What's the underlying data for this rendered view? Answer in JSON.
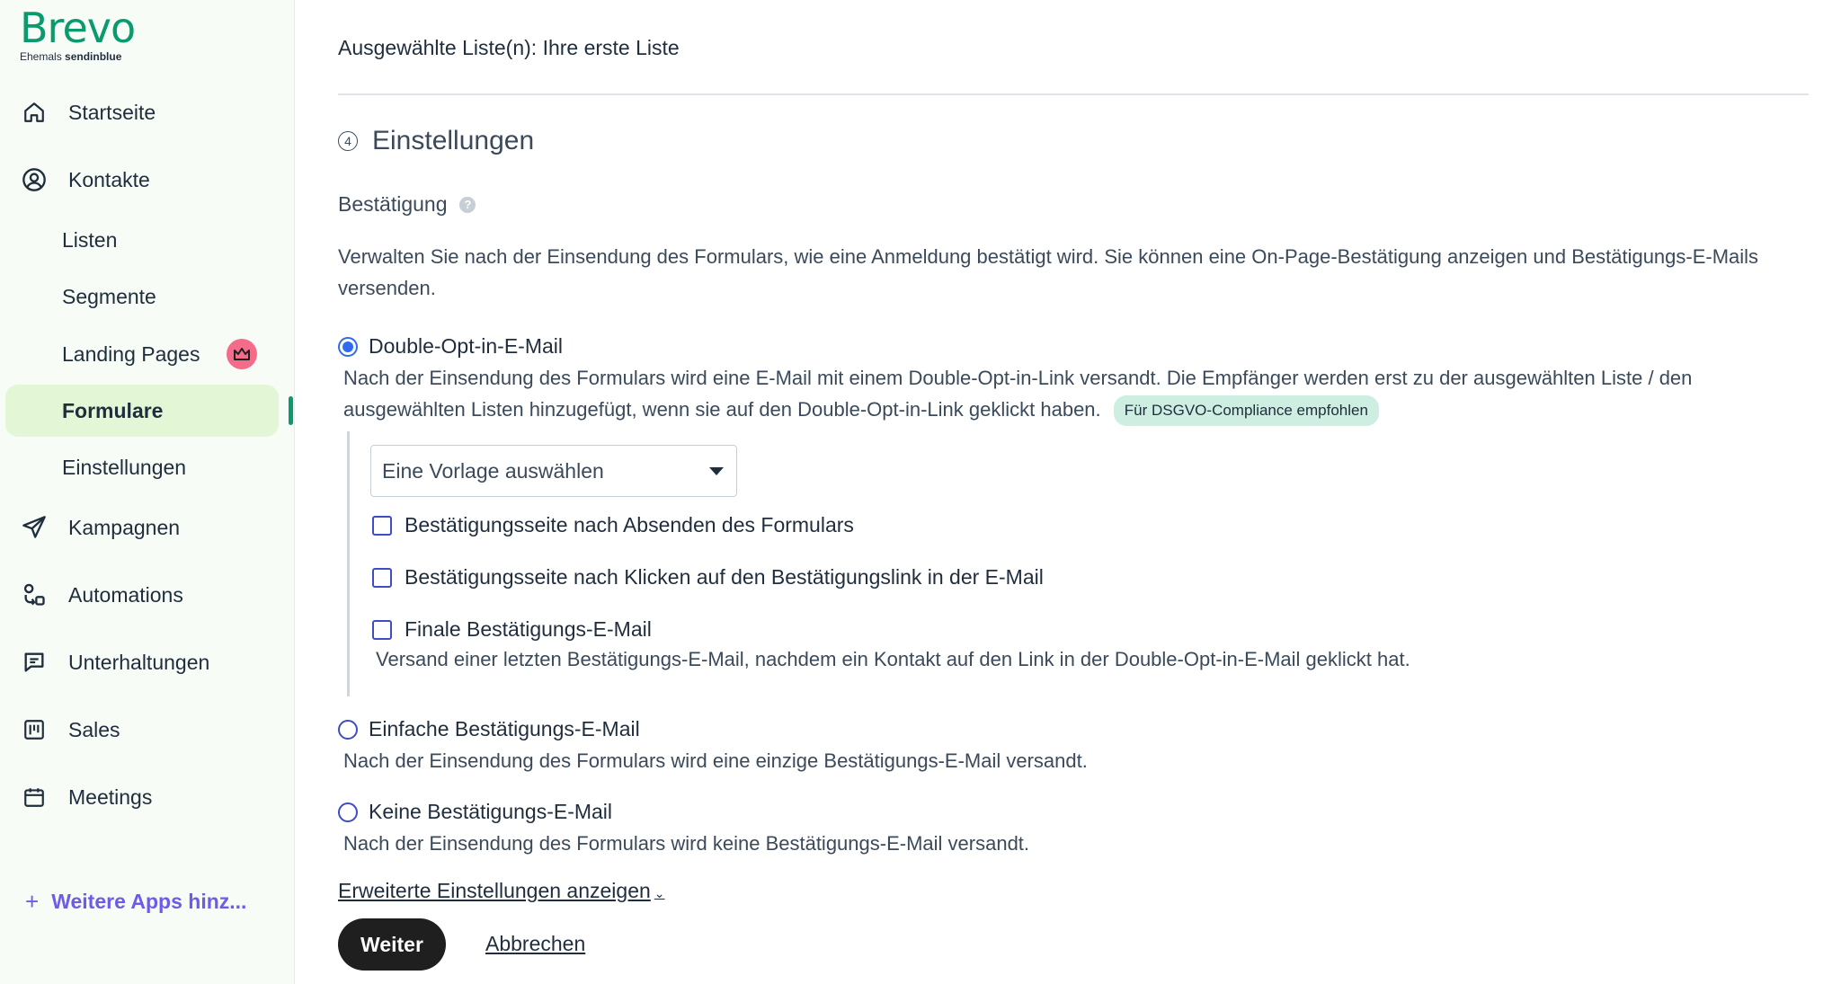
{
  "logo": {
    "word": "Brevo",
    "sub_prefix": "Ehemals",
    "sub_brand": "sendinblue"
  },
  "sidebar": {
    "items": [
      {
        "label": "Startseite",
        "icon": "home-icon"
      },
      {
        "label": "Kontakte",
        "icon": "contacts-icon"
      },
      {
        "label": "Listen"
      },
      {
        "label": "Segmente"
      },
      {
        "label": "Landing Pages",
        "badge_icon": "crown-icon"
      },
      {
        "label": "Formulare",
        "active": true
      },
      {
        "label": "Einstellungen"
      },
      {
        "label": "Kampagnen",
        "icon": "send-icon"
      },
      {
        "label": "Automations",
        "icon": "automations-icon"
      },
      {
        "label": "Unterhaltungen",
        "icon": "chat-icon"
      },
      {
        "label": "Sales",
        "icon": "sales-icon"
      },
      {
        "label": "Meetings",
        "icon": "calendar-icon"
      }
    ],
    "more_apps": {
      "plus": "+",
      "label": "Weitere Apps hinz..."
    }
  },
  "main": {
    "selected_lists": "Ausgewählte Liste(n): Ihre erste Liste",
    "section": {
      "number": "4",
      "title": "Einstellungen"
    },
    "confirmation": {
      "heading": "Bestätigung",
      "description": "Verwalten Sie nach der Einsendung des Formulars, wie eine Anmeldung bestätigt wird. Sie können eine On-Page-Bestätigung anzeigen und Bestätigungs-E-Mails versenden.",
      "options": [
        {
          "label": "Double-Opt-in-E-Mail",
          "checked": true,
          "description": "Nach der Einsendung des Formulars wird eine E-Mail mit einem Double-Opt-in-Link versandt. Die Empfänger werden erst zu der ausgewählten Liste / den ausgewählten Listen hinzugefügt, wenn sie auf den Double-Opt-in-Link geklickt haben.",
          "badge": "Für DSGVO-Compliance empfohlen"
        },
        {
          "label": "Einfache Bestätigungs-E-Mail",
          "checked": false,
          "description": "Nach der Einsendung des Formulars wird eine einzige Bestätigungs-E-Mail versandt."
        },
        {
          "label": "Keine Bestätigungs-E-Mail",
          "checked": false,
          "description": "Nach der Einsendung des Formulars wird keine Bestätigungs-E-Mail versandt."
        }
      ],
      "template_select": "Eine Vorlage auswählen",
      "checkboxes": [
        {
          "label": "Bestätigungsseite nach Absenden des Formulars",
          "checked": false
        },
        {
          "label": "Bestätigungsseite nach Klicken auf den Bestätigungslink in der E-Mail",
          "checked": false
        },
        {
          "label": "Finale Bestätigungs-E-Mail",
          "checked": false,
          "description": "Versand einer letzten Bestätigungs-E-Mail, nachdem ein Kontakt auf den Link in der Double-Opt-in-E-Mail geklickt hat."
        }
      ]
    },
    "advanced_link": "Erweiterte Einstellungen anzeigen",
    "buttons": {
      "next": "Weiter",
      "cancel": "Abbrechen"
    }
  },
  "colors": {
    "brand": "#0b996e",
    "active_bg": "#e3f7d7",
    "accent": "#6c5ce7",
    "radio": "#2e6bf0",
    "badge_bg": "#cdeee0",
    "crown_badge": "#f56c8a"
  }
}
